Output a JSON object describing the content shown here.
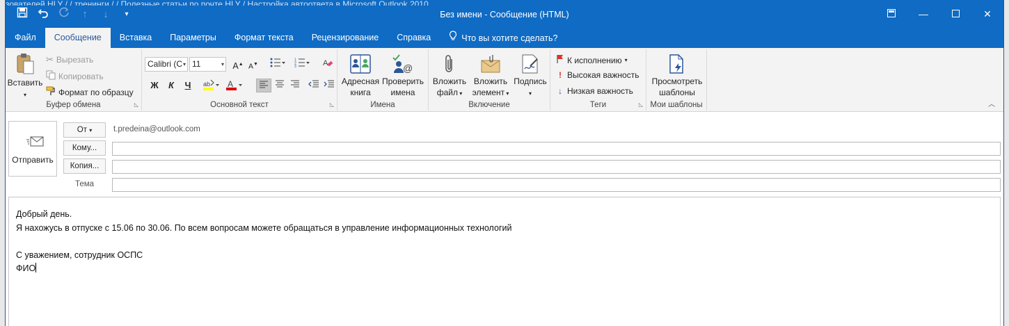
{
  "background_text": "зователей HLY / / тренинги / / Полезные статьи по почте HLY / Настройка автоответа в Microsoft Outlook 2010",
  "window": {
    "title": "Без имени  -  Сообщение (HTML)"
  },
  "qat": {
    "save": "save-icon",
    "undo": "undo-icon",
    "redo": "redo-icon",
    "up": "arrow-up-icon",
    "down": "arrow-down-icon",
    "customize": "customize-icon"
  },
  "tabs": [
    "Файл",
    "Сообщение",
    "Вставка",
    "Параметры",
    "Формат текста",
    "Рецензирование",
    "Справка"
  ],
  "tell_me": "Что вы хотите сделать?",
  "ribbon": {
    "clipboard": {
      "label": "Буфер обмена",
      "paste": "Вставить",
      "cut": "Вырезать",
      "copy": "Копировать",
      "format_painter": "Формат по образцу"
    },
    "basic_text": {
      "label": "Основной текст",
      "font": "Calibri (С",
      "size": "11",
      "bold": "Ж",
      "italic": "К",
      "underline": "Ч"
    },
    "names": {
      "label": "Имена",
      "address_book_1": "Адресная",
      "address_book_2": "книга",
      "check_names_1": "Проверить",
      "check_names_2": "имена"
    },
    "include": {
      "label": "Включение",
      "attach_file_1": "Вложить",
      "attach_file_2": "файл",
      "attach_item_1": "Вложить",
      "attach_item_2": "элемент",
      "signature": "Подпись"
    },
    "tags": {
      "label": "Теги",
      "followup": "К исполнению",
      "high": "Высокая важность",
      "low": "Низкая важность"
    },
    "templates": {
      "label": "Мои шаблоны",
      "view_1": "Просмотреть",
      "view_2": "шаблоны"
    }
  },
  "compose": {
    "send": "Отправить",
    "from_button": "От",
    "from_value": "t.predeina@outlook.com",
    "to_button": "Кому...",
    "cc_button": "Копия...",
    "subject_label": "Тема",
    "to_value": "",
    "cc_value": "",
    "subject_value": ""
  },
  "body_lines": [
    "Добрый день.",
    "Я нахожусь в отпуске с 15.06 по 30.06. По всем вопросам можете обращаться в управление информационных технологий",
    "",
    "С уважением, сотрудник ОСПС",
    "ФИО"
  ],
  "colors": {
    "accent": "#0f6bc4",
    "ribbon_bg": "#f3f3f3",
    "highlight": "#ffff00",
    "font_color": "#e00000",
    "flag_red": "#d9342b",
    "low_blue": "#2b579a"
  }
}
